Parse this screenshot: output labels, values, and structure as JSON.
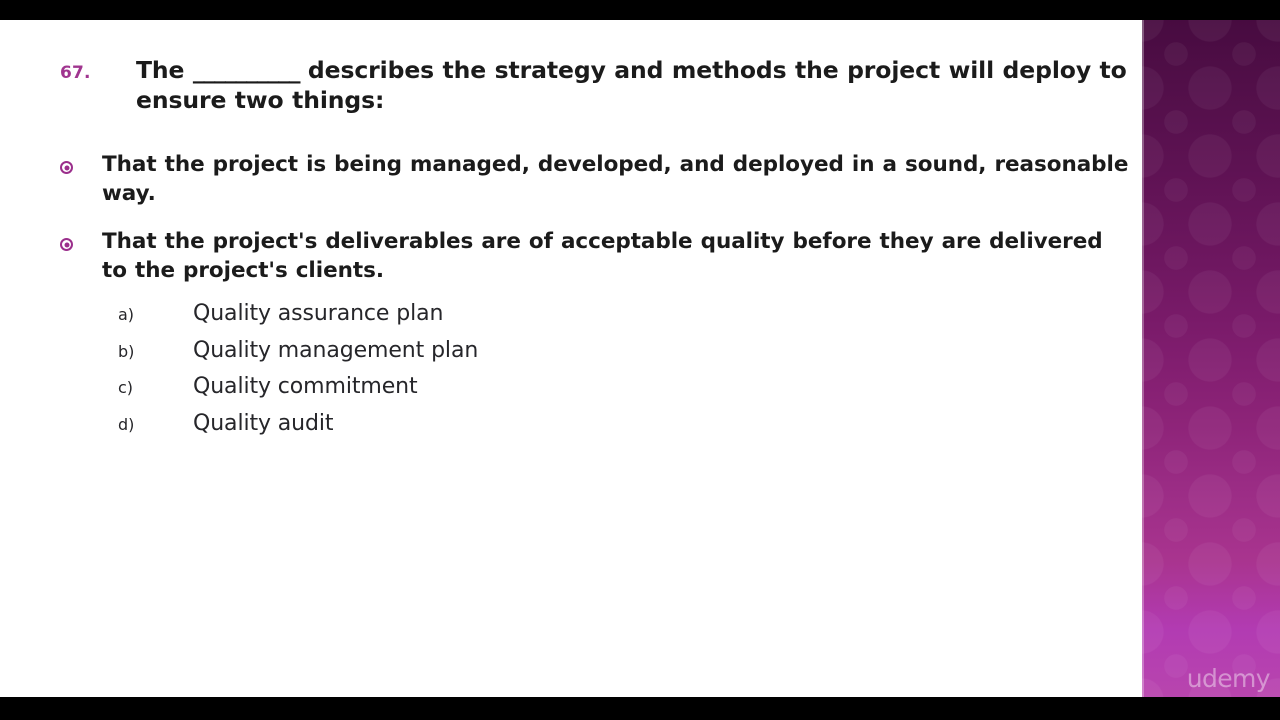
{
  "slide": {
    "question_number": "67.",
    "question_text_before_blank": "The ",
    "blank": "__________",
    "question_text_after_blank": " describes the strategy and methods the project will deploy to ensure two things:",
    "bullets": [
      {
        "icon": "radio-dot-icon",
        "text": "That the project is being managed, developed, and deployed in a sound, reasonable way."
      },
      {
        "icon": "radio-dot-icon",
        "text": "That the project's deliverables are of acceptable quality before they are delivered to the project's clients."
      }
    ],
    "options": [
      {
        "letter": "a)",
        "label": "Quality assurance plan"
      },
      {
        "letter": "b)",
        "label": "Quality management plan"
      },
      {
        "letter": "c)",
        "label": "Quality commitment"
      },
      {
        "letter": "d)",
        "label": "Quality audit"
      }
    ],
    "watermark": "udemy",
    "colors": {
      "question_number": "#a0358f",
      "bullet_accent": "#9b2f8c",
      "body_text": "#1b1b1b",
      "option_text": "#26262a",
      "panel_top": "#470b40",
      "panel_bottom": "#b845ae",
      "letterbox": "#000000",
      "stage": "#ffffff"
    }
  }
}
